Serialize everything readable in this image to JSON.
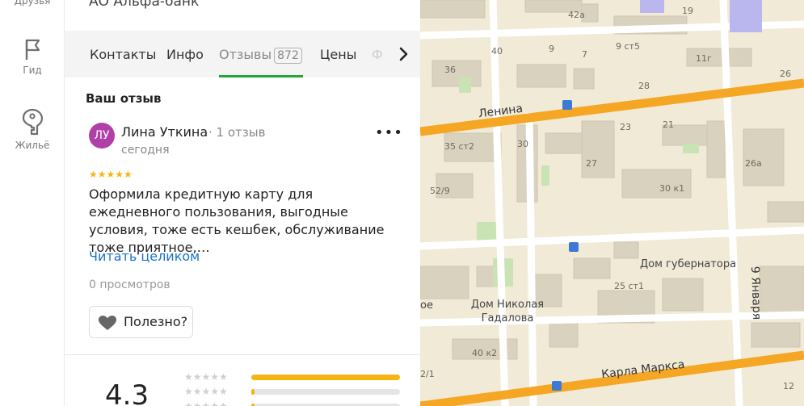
{
  "rail": {
    "friends_label": "Друзья",
    "guide_label": "Гид",
    "housing_label": "Жильё"
  },
  "org": {
    "name": "АО Альфа-банк"
  },
  "tabs": {
    "contacts": "Контакты",
    "info": "Инфо",
    "reviews": "Отзывы",
    "reviews_count": "872",
    "prices": "Цены",
    "photos_partial": "Ф"
  },
  "review": {
    "section_title": "Ваш отзыв",
    "avatar_initials": "ЛУ",
    "author": "Лина Уткина",
    "author_reviews": "1 отзыв",
    "date": "сегодня",
    "stars": 5,
    "text": "Оформила кредитную карту для ежедневного пользования, выгодные условия, тоже есть кешбек, обслуживание тоже приятное,…",
    "read_more": "Читать целиком",
    "views": "0 просмотров",
    "useful": "Полезно?"
  },
  "rating": {
    "value": "4.3",
    "bars": [
      {
        "stars": 5,
        "fraction": 1.0
      },
      {
        "stars": 4,
        "fraction": 0.02
      },
      {
        "stars": 3,
        "fraction": 0.02
      }
    ]
  },
  "map": {
    "streets": [
      "Ленина",
      "Карла Маркса",
      "9 Января"
    ],
    "pois": [
      "Дом губернатора",
      "Дом Николая Гадалова"
    ],
    "house_numbers": [
      "42а",
      "19",
      "40",
      "9",
      "7",
      "9 ст5",
      "11г",
      "36",
      "28",
      "26",
      "23",
      "21",
      "35 ст2",
      "30",
      "27",
      "26а",
      "52/9",
      "30 к1",
      "25 ст1",
      "40 к2",
      "2/1",
      "12"
    ],
    "partial_label": "ое",
    "colors": {
      "road": "#f5a623",
      "street_white": "#ffffff",
      "building": "#d9d2bf",
      "land": "#f0ead7",
      "green": "#c9e3b5"
    }
  }
}
